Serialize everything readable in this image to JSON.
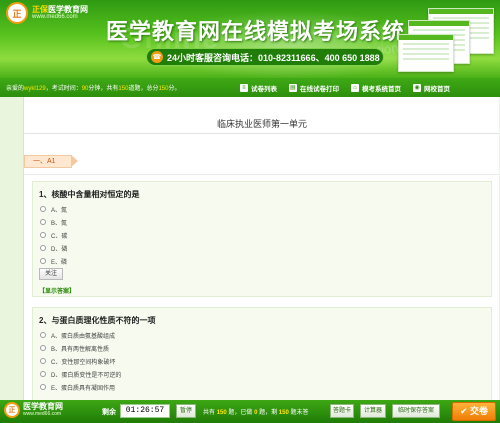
{
  "header": {
    "logo_badge": "正",
    "logo_brand_prefix": "正保",
    "logo_brand": "医学教育网",
    "logo_url": "www.med66.com",
    "title": "医学教育网在线模拟考场系统",
    "watermark_left": "Online",
    "watermark_right": "simulation",
    "hotline": "24小时客服咨询电话：010-82311666、400 650 1888"
  },
  "navbar": {
    "info_prefix": "亲爱的",
    "username": "wykl129",
    "info_mid1": "，考试时间：",
    "exam_minutes": "90",
    "info_mid2": "分钟，共有",
    "question_count": "150",
    "info_mid3": "道题，总分",
    "total_score": "150",
    "info_suffix": "分。",
    "links": [
      {
        "label": "试卷列表",
        "icon": "list-icon"
      },
      {
        "label": "在线试卷打印",
        "icon": "print-icon"
      },
      {
        "label": "模考系统首页",
        "icon": "home-icon"
      },
      {
        "label": "网校首页",
        "icon": "globe-icon"
      }
    ]
  },
  "paper": {
    "title": "临床执业医师第一单元",
    "section": "一、A1"
  },
  "questions": [
    {
      "title": "1、核酸中含量相对恒定的是",
      "options": [
        "A、氮",
        "B、氮",
        "C、碳",
        "D、磷",
        "E、磷"
      ]
    },
    {
      "title": "2、与蛋白质理化性质不符的一项",
      "options": [
        "A、蛋白质由氨基酸组成",
        "B、具有两性解离性质",
        "C、变性那空间构象破坏",
        "D、蛋白质变性是不可逆的",
        "E、蛋白质具有凝固作用"
      ]
    }
  ],
  "question_actions": {
    "follow_label": "关注",
    "show_answer_label": "【显示答案】"
  },
  "footer": {
    "logo_badge": "正",
    "logo_name": "医学教育网",
    "logo_url": "www.med66.com",
    "remain_label": "剩余",
    "timer": "01:26:57",
    "pause_label": "暂停",
    "stats_prefix": "共有",
    "total": "150",
    "stats_mid1": "题，已做",
    "done": "0",
    "stats_mid2": "题，剩",
    "left": "150",
    "stats_suffix": "题未答",
    "answer_card_label": "答题卡",
    "calculator_label": "计算器",
    "save_label": "临时保存答案",
    "submit_label": "交卷",
    "submit_icon": "check-icon"
  },
  "colors": {
    "brand_green": "#3faa15",
    "accent_orange": "#f07d05",
    "highlight_yellow": "#ffe600"
  }
}
